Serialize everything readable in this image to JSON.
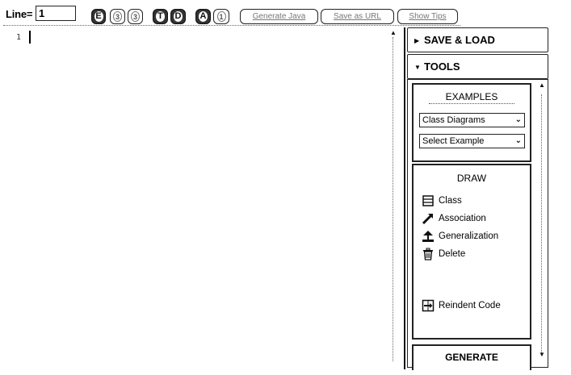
{
  "toolbar": {
    "line_label": "Line=",
    "line_value": "1",
    "buttons": [
      "E",
      "3",
      "3",
      "T",
      "D",
      "A",
      "1"
    ],
    "generate_java_label": "Generate Java",
    "save_as_url_label": "Save as URL",
    "show_tips_label": "Show Tips"
  },
  "editor": {
    "line_numbers": [
      "1"
    ]
  },
  "panel": {
    "save_load_label": "SAVE & LOAD",
    "tools_label": "TOOLS",
    "examples": {
      "title": "EXAMPLES",
      "category_selected": "Class Diagrams",
      "example_selected": "Select Example"
    },
    "draw": {
      "title": "DRAW",
      "items": [
        {
          "label": "Class",
          "icon": "class-icon"
        },
        {
          "label": "Association",
          "icon": "association-icon"
        },
        {
          "label": "Generalization",
          "icon": "generalization-icon"
        },
        {
          "label": "Delete",
          "icon": "trash-icon"
        }
      ],
      "reindent_label": "Reindent Code"
    },
    "generate_label": "GENERATE"
  }
}
